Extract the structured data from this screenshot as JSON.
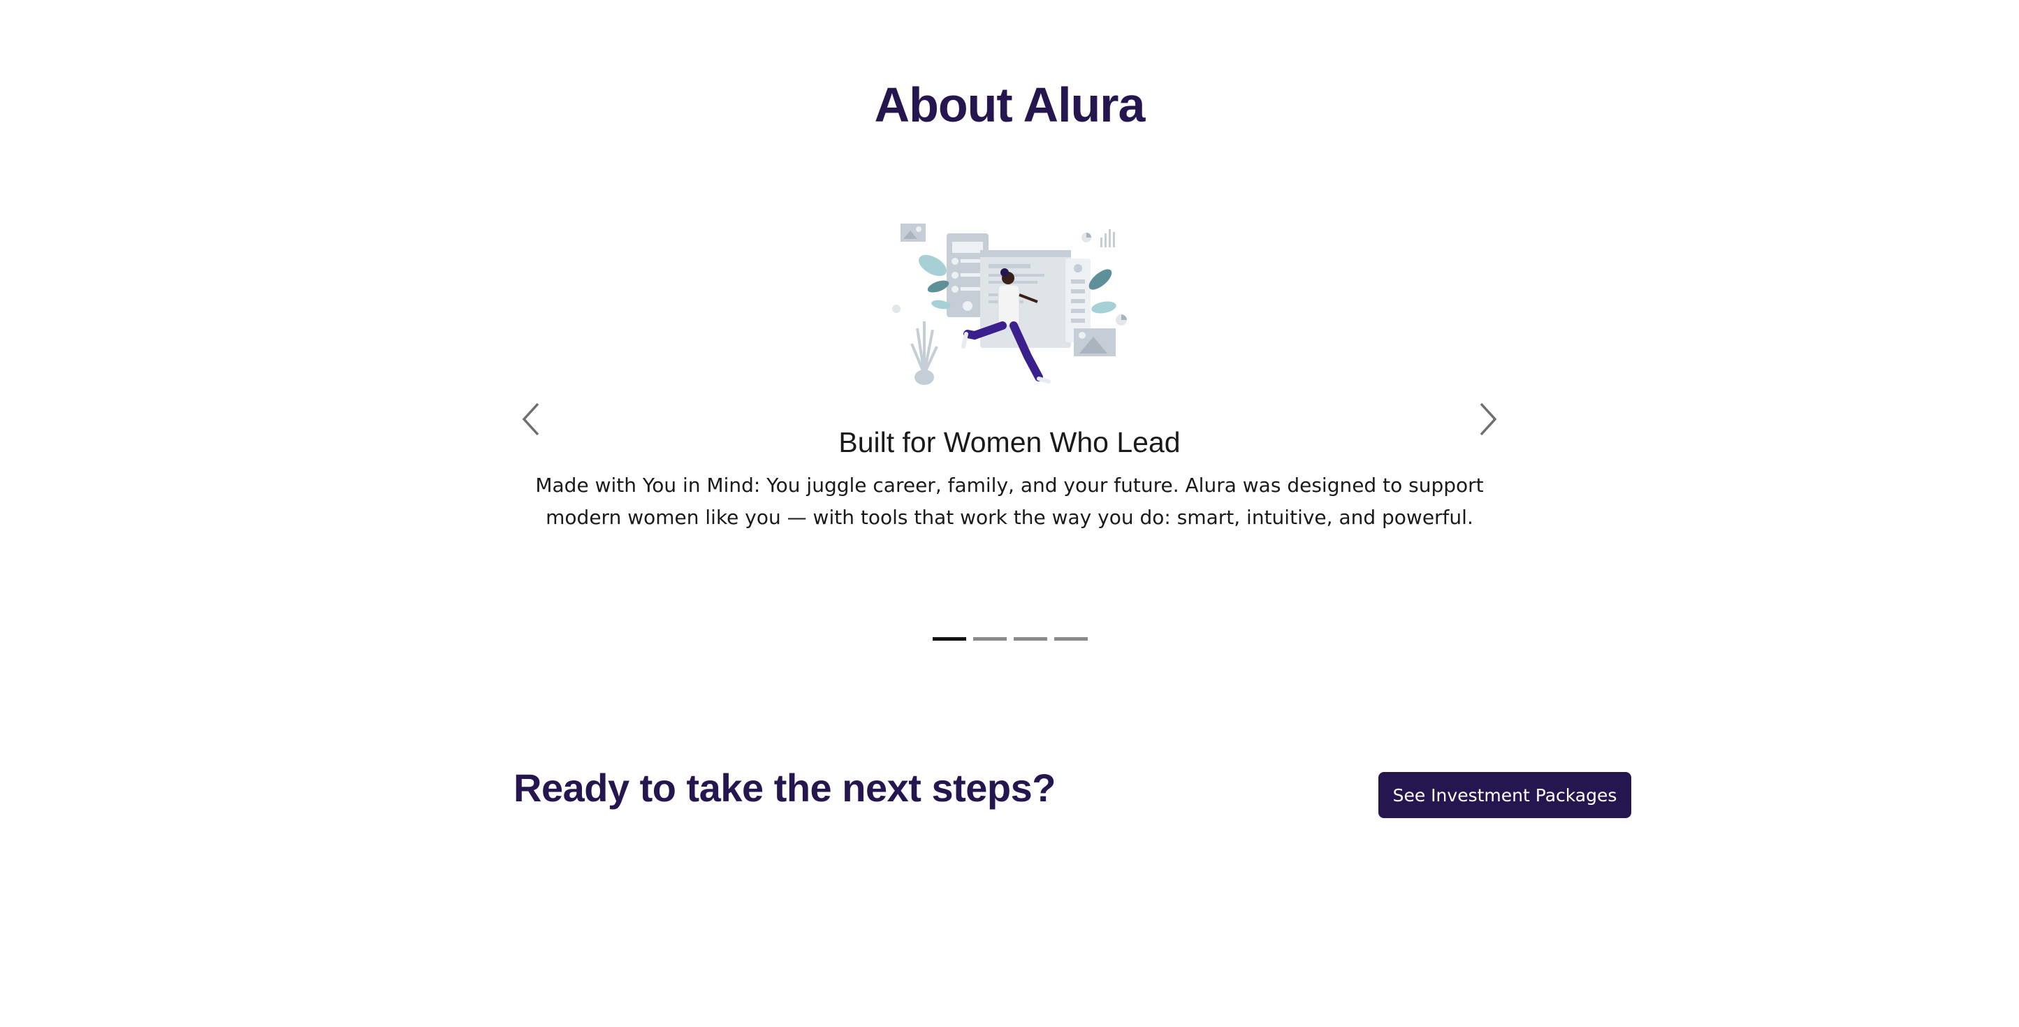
{
  "about": {
    "title": "About Alura"
  },
  "carousel": {
    "slide": {
      "heading": "Built for Women Who Lead",
      "body": "Made with You in Mind: You juggle career, family, and your future. Alura was designed to support modern women like you — with tools that work the way you do: smart, intuitive, and powerful."
    },
    "prev_icon": "chevron-left-icon",
    "next_icon": "chevron-right-icon",
    "indicator_count": 4,
    "active_index": 0
  },
  "cta": {
    "heading": "Ready to take the next steps?",
    "button_label": "See Investment Packages"
  },
  "colors": {
    "brand": "#261650",
    "figure_pants": "#3b1f8c",
    "illustration_gray": "#c5cdd6",
    "leaf_teal": "#5f8f98",
    "leaf_light": "#a7d0d6"
  }
}
